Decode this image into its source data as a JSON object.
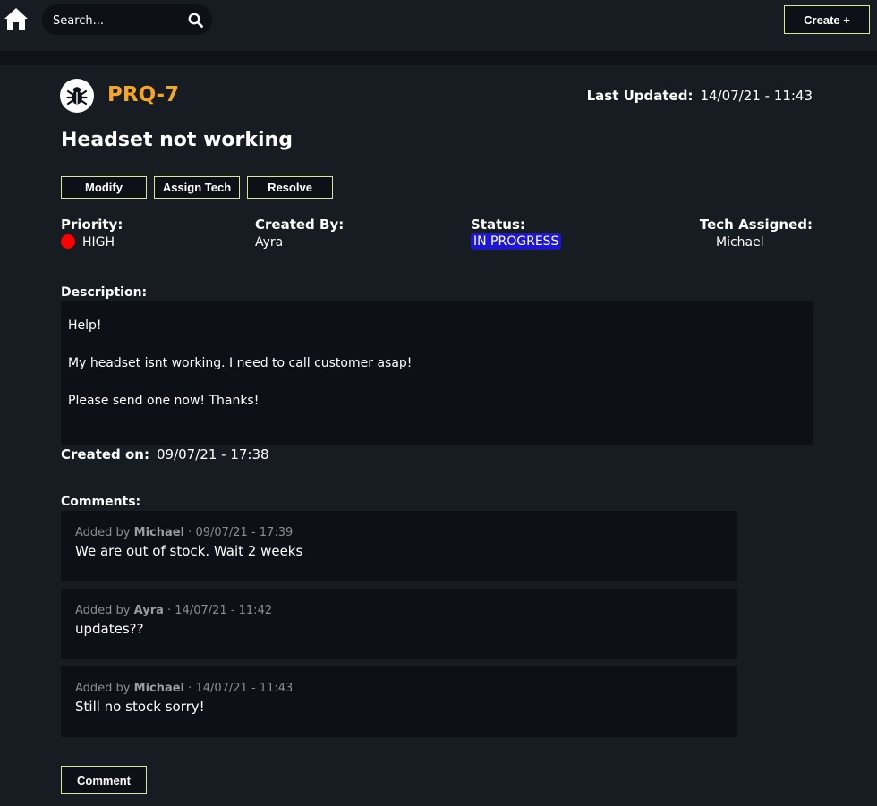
{
  "header": {
    "home_icon": "home-icon",
    "search": {
      "placeholder": "Search...",
      "icon": "search-icon"
    },
    "create_label": "Create +"
  },
  "ticket": {
    "icon": "bug-icon",
    "id": "PRQ-7",
    "last_updated_label": "Last Updated:",
    "last_updated_value": "14/07/21 - 11:43",
    "title": "Headset not working",
    "actions": {
      "modify": "Modify",
      "assign_tech": "Assign Tech",
      "resolve": "Resolve"
    },
    "fields": {
      "priority_label": "Priority:",
      "priority_value": "HIGH",
      "priority_color": "#ff0000",
      "created_by_label": "Created By:",
      "created_by_value": "Ayra",
      "status_label": "Status:",
      "status_value": "IN PROGRESS",
      "status_color": "#1d16d6",
      "tech_label": "Tech Assigned:",
      "tech_value": "Michael"
    },
    "description_label": "Description:",
    "description_lines": [
      "Help!",
      "My headset isnt working. I need to call customer asap!",
      "Please send one now! Thanks!"
    ],
    "created_on_label": "Created on:",
    "created_on_value": "09/07/21 - 17:38"
  },
  "comments": {
    "label": "Comments:",
    "items": [
      {
        "added_by": "Added by",
        "author": "Michael",
        "timestamp": " · 09/07/21 - 17:39",
        "text": "We are out of stock. Wait 2 weeks"
      },
      {
        "added_by": "Added by",
        "author": "Ayra",
        "timestamp": " · 14/07/21 - 11:42",
        "text": "updates??"
      },
      {
        "added_by": "Added by",
        "author": "Michael",
        "timestamp": " · 14/07/21 - 11:43",
        "text": "Still no stock sorry!"
      }
    ],
    "button_label": "Comment"
  },
  "theme": {
    "accent": "#f5a623",
    "button_border": "#d9e88a",
    "background": "#171b22",
    "panel": "#0d1016"
  }
}
